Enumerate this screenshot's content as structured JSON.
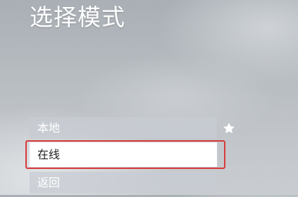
{
  "screen": {
    "title": "选择模式"
  },
  "menu": {
    "items": [
      {
        "label": "本地",
        "selected": false,
        "has_star": true
      },
      {
        "label": "在线",
        "selected": true,
        "has_star": false
      },
      {
        "label": "返回",
        "selected": false,
        "has_star": false
      }
    ],
    "star_icon": "star-icon",
    "highlight_color": "#d83a3a"
  }
}
